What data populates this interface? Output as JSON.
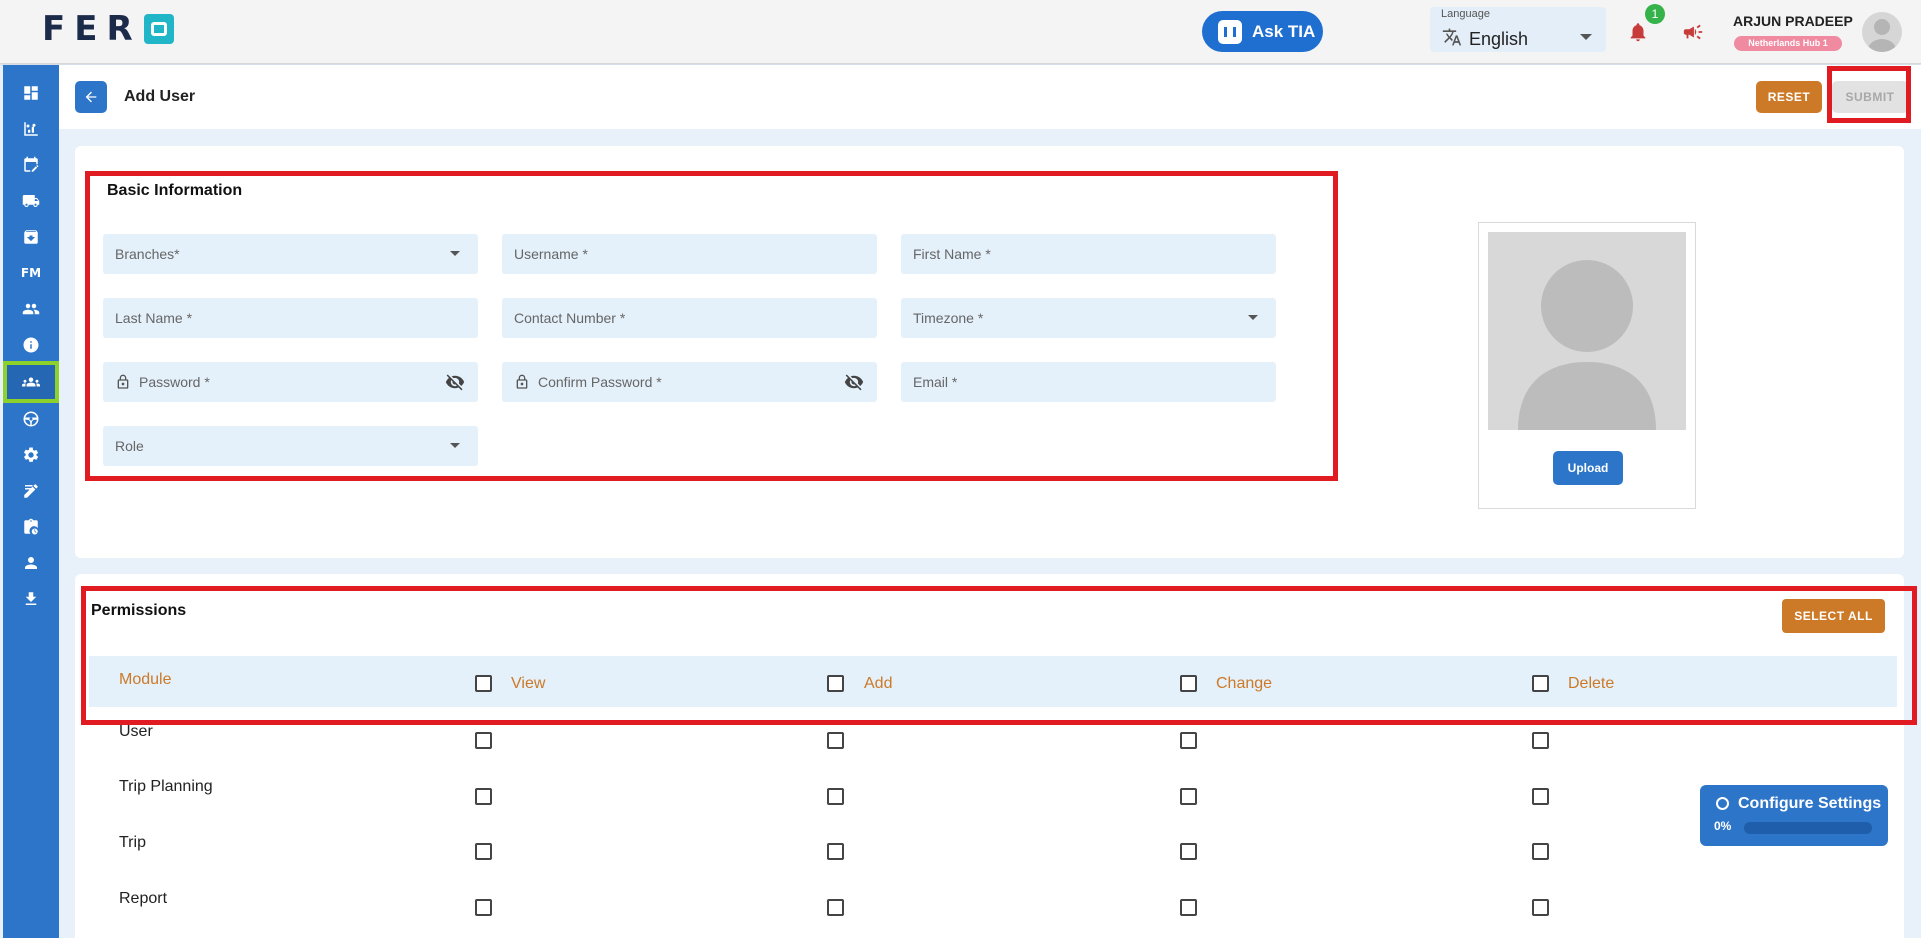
{
  "topbar": {
    "logo_text": "FER",
    "ask_tia_label": "Ask TIA",
    "language_label": "Language",
    "language_value": "English",
    "notification_count": "1",
    "user_name": "ARJUN PRADEEP",
    "user_hub": "Netherlands Hub 1"
  },
  "sidebar": {
    "items": [
      {
        "icon": "dashboard-icon"
      },
      {
        "icon": "analytics-icon"
      },
      {
        "icon": "calendar-edit-icon"
      },
      {
        "icon": "truck-icon"
      },
      {
        "icon": "archive-icon"
      },
      {
        "icon": "fm-icon",
        "label": "FM"
      },
      {
        "icon": "users-icon"
      },
      {
        "icon": "info-icon"
      },
      {
        "icon": "user-group-icon",
        "active": true
      },
      {
        "icon": "steering-wheel-icon"
      },
      {
        "icon": "settings-icon"
      },
      {
        "icon": "note-edit-icon"
      },
      {
        "icon": "clipboard-icon"
      },
      {
        "icon": "person-icon"
      },
      {
        "icon": "download-icon"
      }
    ]
  },
  "header": {
    "title": "Add User",
    "reset_label": "RESET",
    "submit_label": "SUBMIT"
  },
  "basic": {
    "title": "Basic Information",
    "fields": {
      "branches": "Branches*",
      "username": "Username *",
      "first_name": "First Name *",
      "last_name": "Last Name *",
      "contact": "Contact Number *",
      "timezone": "Timezone *",
      "password": "Password *",
      "confirm_password": "Confirm Password *",
      "email": "Email *",
      "role": "Role"
    },
    "upload_label": "Upload"
  },
  "permissions": {
    "title": "Permissions",
    "select_all_label": "SELECT ALL",
    "columns": [
      "Module",
      "View",
      "Add",
      "Change",
      "Delete"
    ],
    "rows": [
      "User",
      "Trip Planning",
      "Trip",
      "Report"
    ]
  },
  "configure": {
    "title": "Configure Settings",
    "percent_label": "0%",
    "progress": 0
  },
  "colors": {
    "primary": "#2d75c9",
    "accent": "#cc7a27",
    "annotation": "#e11b22",
    "active_highlight": "#8cd12c"
  }
}
